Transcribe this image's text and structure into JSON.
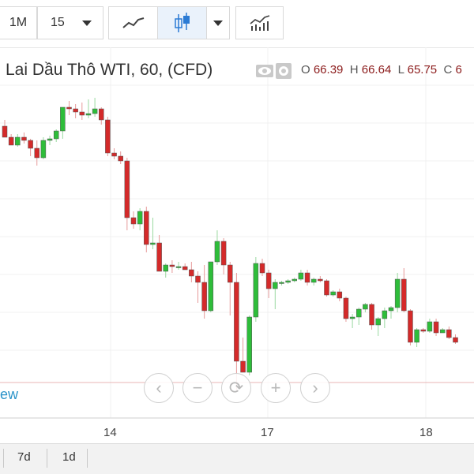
{
  "toolbar": {
    "range_1m_label": "1M",
    "interval_label": "15",
    "items": [
      {
        "name": "range-1m-button",
        "label": "1M"
      },
      {
        "name": "interval-select",
        "label": "15"
      },
      {
        "name": "line-chart-icon"
      },
      {
        "name": "candlestick-icon",
        "active": true
      },
      {
        "name": "indicators-icon"
      }
    ]
  },
  "legend": {
    "title": "Lai Dầu Thô WTI, 60, (CFD)",
    "o_label": "O",
    "o_value": "66.39",
    "h_label": "H",
    "h_value": "66.64",
    "l_label": "L",
    "l_value": "65.75",
    "c_label": "C",
    "c_value": "6"
  },
  "chart_data": {
    "type": "candlestick",
    "title": "Lai Dầu Thô WTI, 60, (CFD)",
    "xlabel": "",
    "ylabel": "",
    "x_tick_labels": [
      "14",
      "17",
      "18"
    ],
    "y_range": [
      0,
      100
    ],
    "y_units_note": "relative price level (axis values not visible in screenshot)",
    "colors": {
      "up": "#2ebd3a",
      "down": "#d42a2a"
    },
    "candles": [
      {
        "o": 71.0,
        "h": 73.0,
        "l": 69.0,
        "c": 67.5
      },
      {
        "o": 67.5,
        "h": 68.5,
        "l": 66.0,
        "c": 65.0
      },
      {
        "o": 65.0,
        "h": 68.5,
        "l": 64.5,
        "c": 67.5
      },
      {
        "o": 67.5,
        "h": 69.0,
        "l": 65.5,
        "c": 66.5
      },
      {
        "o": 66.5,
        "h": 67.0,
        "l": 61.5,
        "c": 64.0
      },
      {
        "o": 64.0,
        "h": 66.5,
        "l": 58.5,
        "c": 61.0
      },
      {
        "o": 61.0,
        "h": 67.5,
        "l": 60.5,
        "c": 66.5
      },
      {
        "o": 66.5,
        "h": 68.0,
        "l": 65.0,
        "c": 67.0
      },
      {
        "o": 67.0,
        "h": 70.0,
        "l": 66.0,
        "c": 69.5
      },
      {
        "o": 69.5,
        "h": 76.0,
        "l": 67.0,
        "c": 77.0
      },
      {
        "o": 77.0,
        "h": 79.0,
        "l": 74.5,
        "c": 76.5
      },
      {
        "o": 76.5,
        "h": 78.0,
        "l": 73.5,
        "c": 75.5
      },
      {
        "o": 75.5,
        "h": 78.5,
        "l": 73.0,
        "c": 74.5
      },
      {
        "o": 74.5,
        "h": 79.5,
        "l": 73.5,
        "c": 75.0
      },
      {
        "o": 75.0,
        "h": 80.0,
        "l": 74.0,
        "c": 76.5
      },
      {
        "o": 76.5,
        "h": 77.0,
        "l": 71.5,
        "c": 73.0
      },
      {
        "o": 73.0,
        "h": 74.0,
        "l": 61.5,
        "c": 62.5
      },
      {
        "o": 62.5,
        "h": 64.0,
        "l": 60.5,
        "c": 61.5
      },
      {
        "o": 61.5,
        "h": 63.0,
        "l": 59.0,
        "c": 60.0
      },
      {
        "o": 60.0,
        "h": 61.0,
        "l": 38.0,
        "c": 42.0
      },
      {
        "o": 42.0,
        "h": 44.0,
        "l": 38.5,
        "c": 40.0
      },
      {
        "o": 40.0,
        "h": 45.0,
        "l": 38.0,
        "c": 44.0
      },
      {
        "o": 44.0,
        "h": 45.5,
        "l": 31.0,
        "c": 33.5
      },
      {
        "o": 33.5,
        "h": 42.0,
        "l": 32.0,
        "c": 34.0
      },
      {
        "o": 34.0,
        "h": 36.5,
        "l": 25.0,
        "c": 25.0
      },
      {
        "o": 25.0,
        "h": 27.5,
        "l": 23.0,
        "c": 27.0
      },
      {
        "o": 27.0,
        "h": 28.5,
        "l": 24.5,
        "c": 26.5
      },
      {
        "o": 26.5,
        "h": 28.0,
        "l": 25.5,
        "c": 26.5
      },
      {
        "o": 26.5,
        "h": 27.5,
        "l": 25.5,
        "c": 25.5
      },
      {
        "o": 25.5,
        "h": 28.0,
        "l": 21.5,
        "c": 23.5
      },
      {
        "o": 23.5,
        "h": 25.0,
        "l": 15.0,
        "c": 21.5
      },
      {
        "o": 21.5,
        "h": 27.0,
        "l": 10.0,
        "c": 12.5
      },
      {
        "o": 12.5,
        "h": 28.0,
        "l": 12.0,
        "c": 28.0
      },
      {
        "o": 28.0,
        "h": 38.0,
        "l": 27.0,
        "c": 34.5
      },
      {
        "o": 34.5,
        "h": 35.5,
        "l": 24.0,
        "c": 27.0
      },
      {
        "o": 27.0,
        "h": 28.0,
        "l": 11.0,
        "c": 21.5
      },
      {
        "o": 21.5,
        "h": 24.5,
        "l": -13.0,
        "c": -3.5
      },
      {
        "o": -3.5,
        "h": 4.0,
        "l": -7.0,
        "c": -7.0
      },
      {
        "o": -7.0,
        "h": 11.0,
        "l": -8.0,
        "c": 10.5
      },
      {
        "o": 10.5,
        "h": 29.5,
        "l": 9.0,
        "c": 27.5
      },
      {
        "o": 27.5,
        "h": 29.0,
        "l": 23.5,
        "c": 24.5
      },
      {
        "o": 24.5,
        "h": 25.5,
        "l": 16.5,
        "c": 19.5
      },
      {
        "o": 19.5,
        "h": 22.5,
        "l": 13.0,
        "c": 21.5
      },
      {
        "o": 21.5,
        "h": 22.0,
        "l": 20.5,
        "c": 21.5
      },
      {
        "o": 21.5,
        "h": 22.5,
        "l": 21.0,
        "c": 22.0
      },
      {
        "o": 22.0,
        "h": 23.0,
        "l": 21.5,
        "c": 22.5
      },
      {
        "o": 22.5,
        "h": 25.5,
        "l": 22.0,
        "c": 24.5
      },
      {
        "o": 24.5,
        "h": 25.5,
        "l": 20.5,
        "c": 21.5
      },
      {
        "o": 21.5,
        "h": 23.0,
        "l": 20.5,
        "c": 22.5
      },
      {
        "o": 22.5,
        "h": 23.5,
        "l": 21.5,
        "c": 22.0
      },
      {
        "o": 22.0,
        "h": 22.5,
        "l": 17.0,
        "c": 17.5
      },
      {
        "o": 17.5,
        "h": 19.0,
        "l": 17.0,
        "c": 18.5
      },
      {
        "o": 18.5,
        "h": 19.5,
        "l": 15.5,
        "c": 16.5
      },
      {
        "o": 16.5,
        "h": 17.0,
        "l": 9.0,
        "c": 10.0
      },
      {
        "o": 10.0,
        "h": 11.5,
        "l": 7.0,
        "c": 10.5
      },
      {
        "o": 10.5,
        "h": 13.5,
        "l": 8.0,
        "c": 13.0
      },
      {
        "o": 13.0,
        "h": 15.0,
        "l": 12.0,
        "c": 14.5
      },
      {
        "o": 14.5,
        "h": 15.0,
        "l": 6.5,
        "c": 8.0
      },
      {
        "o": 8.0,
        "h": 10.5,
        "l": 4.5,
        "c": 10.0
      },
      {
        "o": 10.0,
        "h": 13.5,
        "l": 7.0,
        "c": 12.5
      },
      {
        "o": 12.5,
        "h": 14.0,
        "l": 10.0,
        "c": 13.5
      },
      {
        "o": 13.5,
        "h": 24.5,
        "l": 12.0,
        "c": 22.5
      },
      {
        "o": 22.5,
        "h": 26.0,
        "l": 12.0,
        "c": 12.5
      },
      {
        "o": 12.5,
        "h": 13.0,
        "l": 1.5,
        "c": 2.5
      },
      {
        "o": 2.5,
        "h": 7.0,
        "l": 1.0,
        "c": 6.5
      },
      {
        "o": 6.5,
        "h": 7.0,
        "l": 5.5,
        "c": 6.0
      },
      {
        "o": 6.0,
        "h": 10.0,
        "l": 5.5,
        "c": 9.0
      },
      {
        "o": 9.0,
        "h": 10.0,
        "l": 4.5,
        "c": 5.5
      },
      {
        "o": 5.5,
        "h": 7.0,
        "l": 6.0,
        "c": 6.5
      },
      {
        "o": 6.5,
        "h": 7.5,
        "l": 3.5,
        "c": 4.0
      },
      {
        "o": 4.0,
        "h": 5.0,
        "l": 2.0,
        "c": 2.5
      }
    ],
    "grid": true,
    "legend_position": "top-left"
  },
  "zoom_controls": {
    "back_glyph": "‹",
    "zoom_out_glyph": "−",
    "reset_glyph": "⟳",
    "zoom_in_glyph": "+",
    "forward_glyph": "›"
  },
  "x_axis_labels": [
    "14",
    "17",
    "18"
  ],
  "new_link_text": "ew",
  "bottom_bar": {
    "ranges": [
      "7d",
      "1d"
    ]
  }
}
